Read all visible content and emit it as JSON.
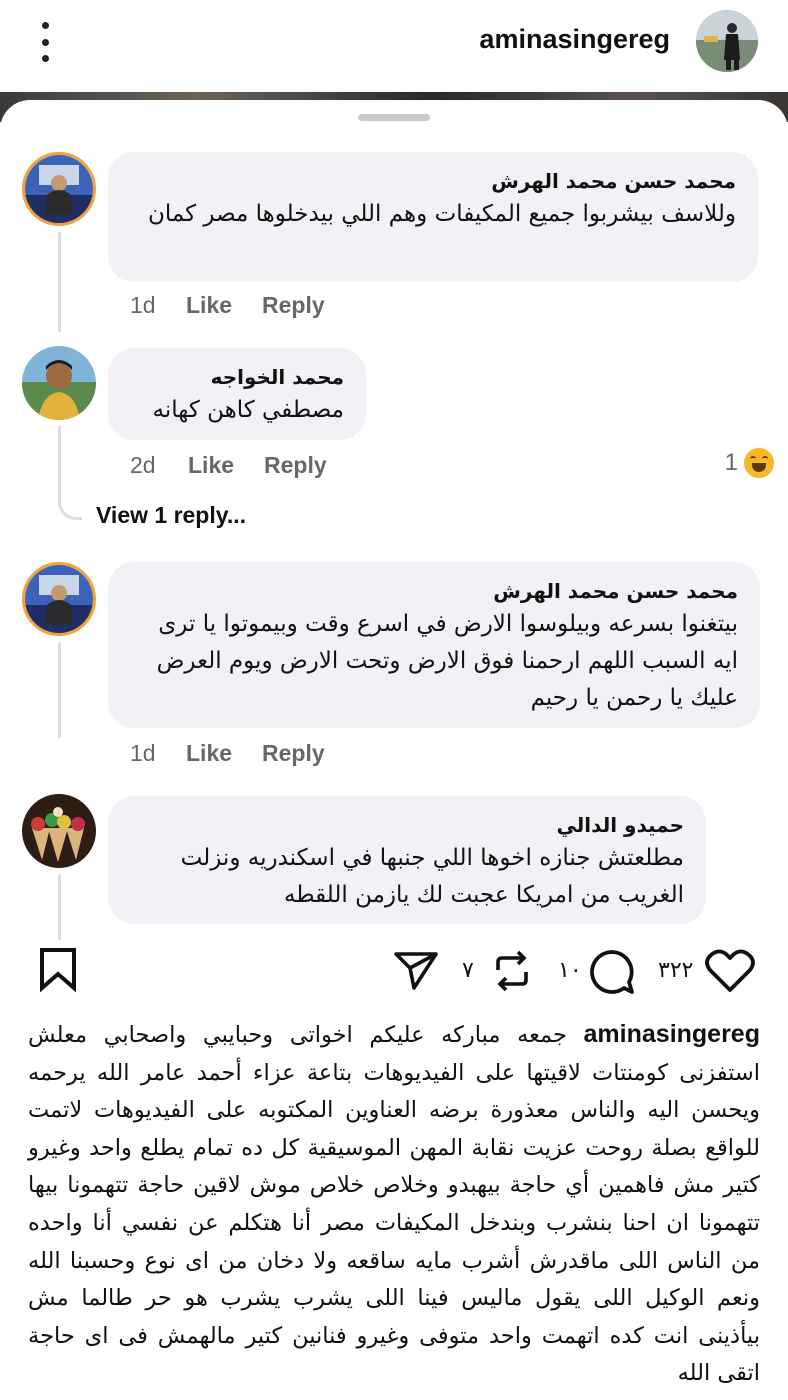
{
  "header": {
    "username": "aminasingereg",
    "more_icon": "more-vertical-icon",
    "avatar_icon": "profile-avatar"
  },
  "comments": [
    {
      "author": "محمد حسن محمد الهرش",
      "text": "وللاسف بيشربوا جميع المكيفات وهم اللي بيدخلوها مصر كمان",
      "time": "1d",
      "like_label": "Like",
      "reply_label": "Reply"
    },
    {
      "author": "محمد الخواجه",
      "text": "مصطفي كاهن كهانه",
      "time": "2d",
      "like_label": "Like",
      "reply_label": "Reply",
      "reaction_count": "1",
      "reaction_icon": "laughing-emoji-icon",
      "view_replies": "View 1 reply..."
    },
    {
      "author": "محمد حسن محمد الهرش",
      "text": "بيتغنوا بسرعه وبيلوسوا الارض في اسرع وقت وبيموتوا يا ترى ايه السبب اللهم ارحمنا فوق الارض وتحت الارض ويوم العرض عليك يا رحمن يا رحيم",
      "time": "1d",
      "like_label": "Like",
      "reply_label": "Reply"
    },
    {
      "author": "حميدو الدالي",
      "text": "مطلعتش جنازه اخوها اللي جنبها في اسكندريه ونزلت الغريب من امريكا عجبت لك يازمن اللقطه"
    }
  ],
  "post_actions": {
    "likes": "٣٢٢",
    "comments": "١٠",
    "reposts": "٧",
    "like_icon": "heart-icon",
    "comment_icon": "comment-bubble-icon",
    "repost_icon": "repost-icon",
    "share_icon": "send-icon",
    "save_icon": "bookmark-icon"
  },
  "caption": {
    "username": "aminasingereg",
    "text": "جمعه مباركه عليكم اخواتى وحبايبي واصحابي معلش استفزنى كومنتات لاقيتها على الفيديوهات بتاعة عزاء أحمد عامر الله يرحمه ويحسن اليه والناس معذورة برضه العناوين المكتوبه على الفيديوهات لاتمت للواقع بصلة روحت عزيت نقابة المهن الموسيقية كل ده تمام يطلع واحد وغيرو كتير مش فاهمين أي حاجة بيهبدو وخلاص خلاص موش لاقين حاجة تتهمونا بيها تتهمونا ان احنا بنشرب وبندخل المكيفات مصر أنا هتكلم عن نفسي أنا واحده من الناس اللى ماقدرش أشرب مايه ساقعه ولا دخان من اى نوع وحسبنا الله ونعم الوكيل اللى يقول ماليس فينا اللى يشرب يشرب هو حر طالما مش بيأذينى انت كده اتهمت واحد متوفى وغيرو فنانين كتير مالهمش فى اى حاجة اتقى الله"
  }
}
